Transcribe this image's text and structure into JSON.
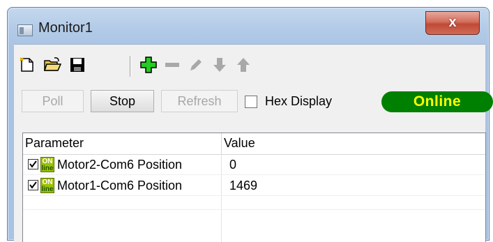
{
  "window": {
    "title": "Monitor1",
    "close_glyph": "x"
  },
  "toolbar": {
    "icons": [
      "new-file-icon",
      "open-folder-icon",
      "save-disk-icon",
      "add-plus-icon",
      "remove-minus-icon",
      "edit-pencil-icon",
      "move-down-arrow-icon",
      "move-up-arrow-icon"
    ]
  },
  "controls": {
    "poll_label": "Poll",
    "stop_label": "Stop",
    "refresh_label": "Refresh",
    "hex_display_label": "Hex Display",
    "hex_display_checked": false,
    "status_label": "Online",
    "status_color": "#008000",
    "status_text_color": "#ffff00"
  },
  "grid": {
    "columns": [
      "Parameter",
      "Value"
    ],
    "rows": [
      {
        "checked": true,
        "badge_top": "ON",
        "badge_bottom": "line",
        "parameter": "Motor2-Com6 Position",
        "value": "0"
      },
      {
        "checked": true,
        "badge_top": "ON",
        "badge_bottom": "line",
        "parameter": "Motor1-Com6 Position",
        "value": "1469"
      }
    ]
  }
}
